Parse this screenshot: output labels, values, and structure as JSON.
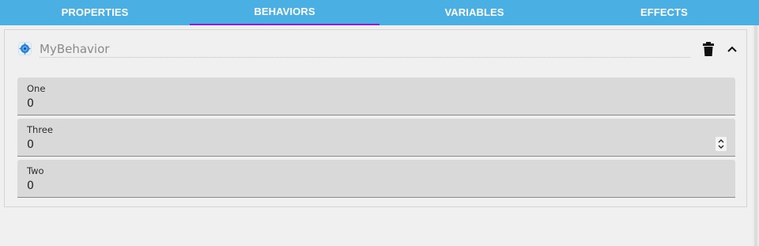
{
  "tabs": [
    {
      "label": "PROPERTIES"
    },
    {
      "label": "BEHAVIORS"
    },
    {
      "label": "VARIABLES"
    },
    {
      "label": "EFFECTS"
    }
  ],
  "active_tab": "BEHAVIORS",
  "colors": {
    "tabbar": "#4ab0e4",
    "active_indicator": "#8b1fd6",
    "field_background": "#d9d9d9"
  },
  "behavior": {
    "name": "MyBehavior",
    "icon": "behavior-icon",
    "actions": [
      "trash-icon",
      "chevron-up-icon"
    ]
  },
  "fields": [
    {
      "label": "One",
      "value": "0"
    },
    {
      "label": "Three",
      "value": "0",
      "control": "number-stepper"
    },
    {
      "label": "Two",
      "value": "0"
    }
  ]
}
